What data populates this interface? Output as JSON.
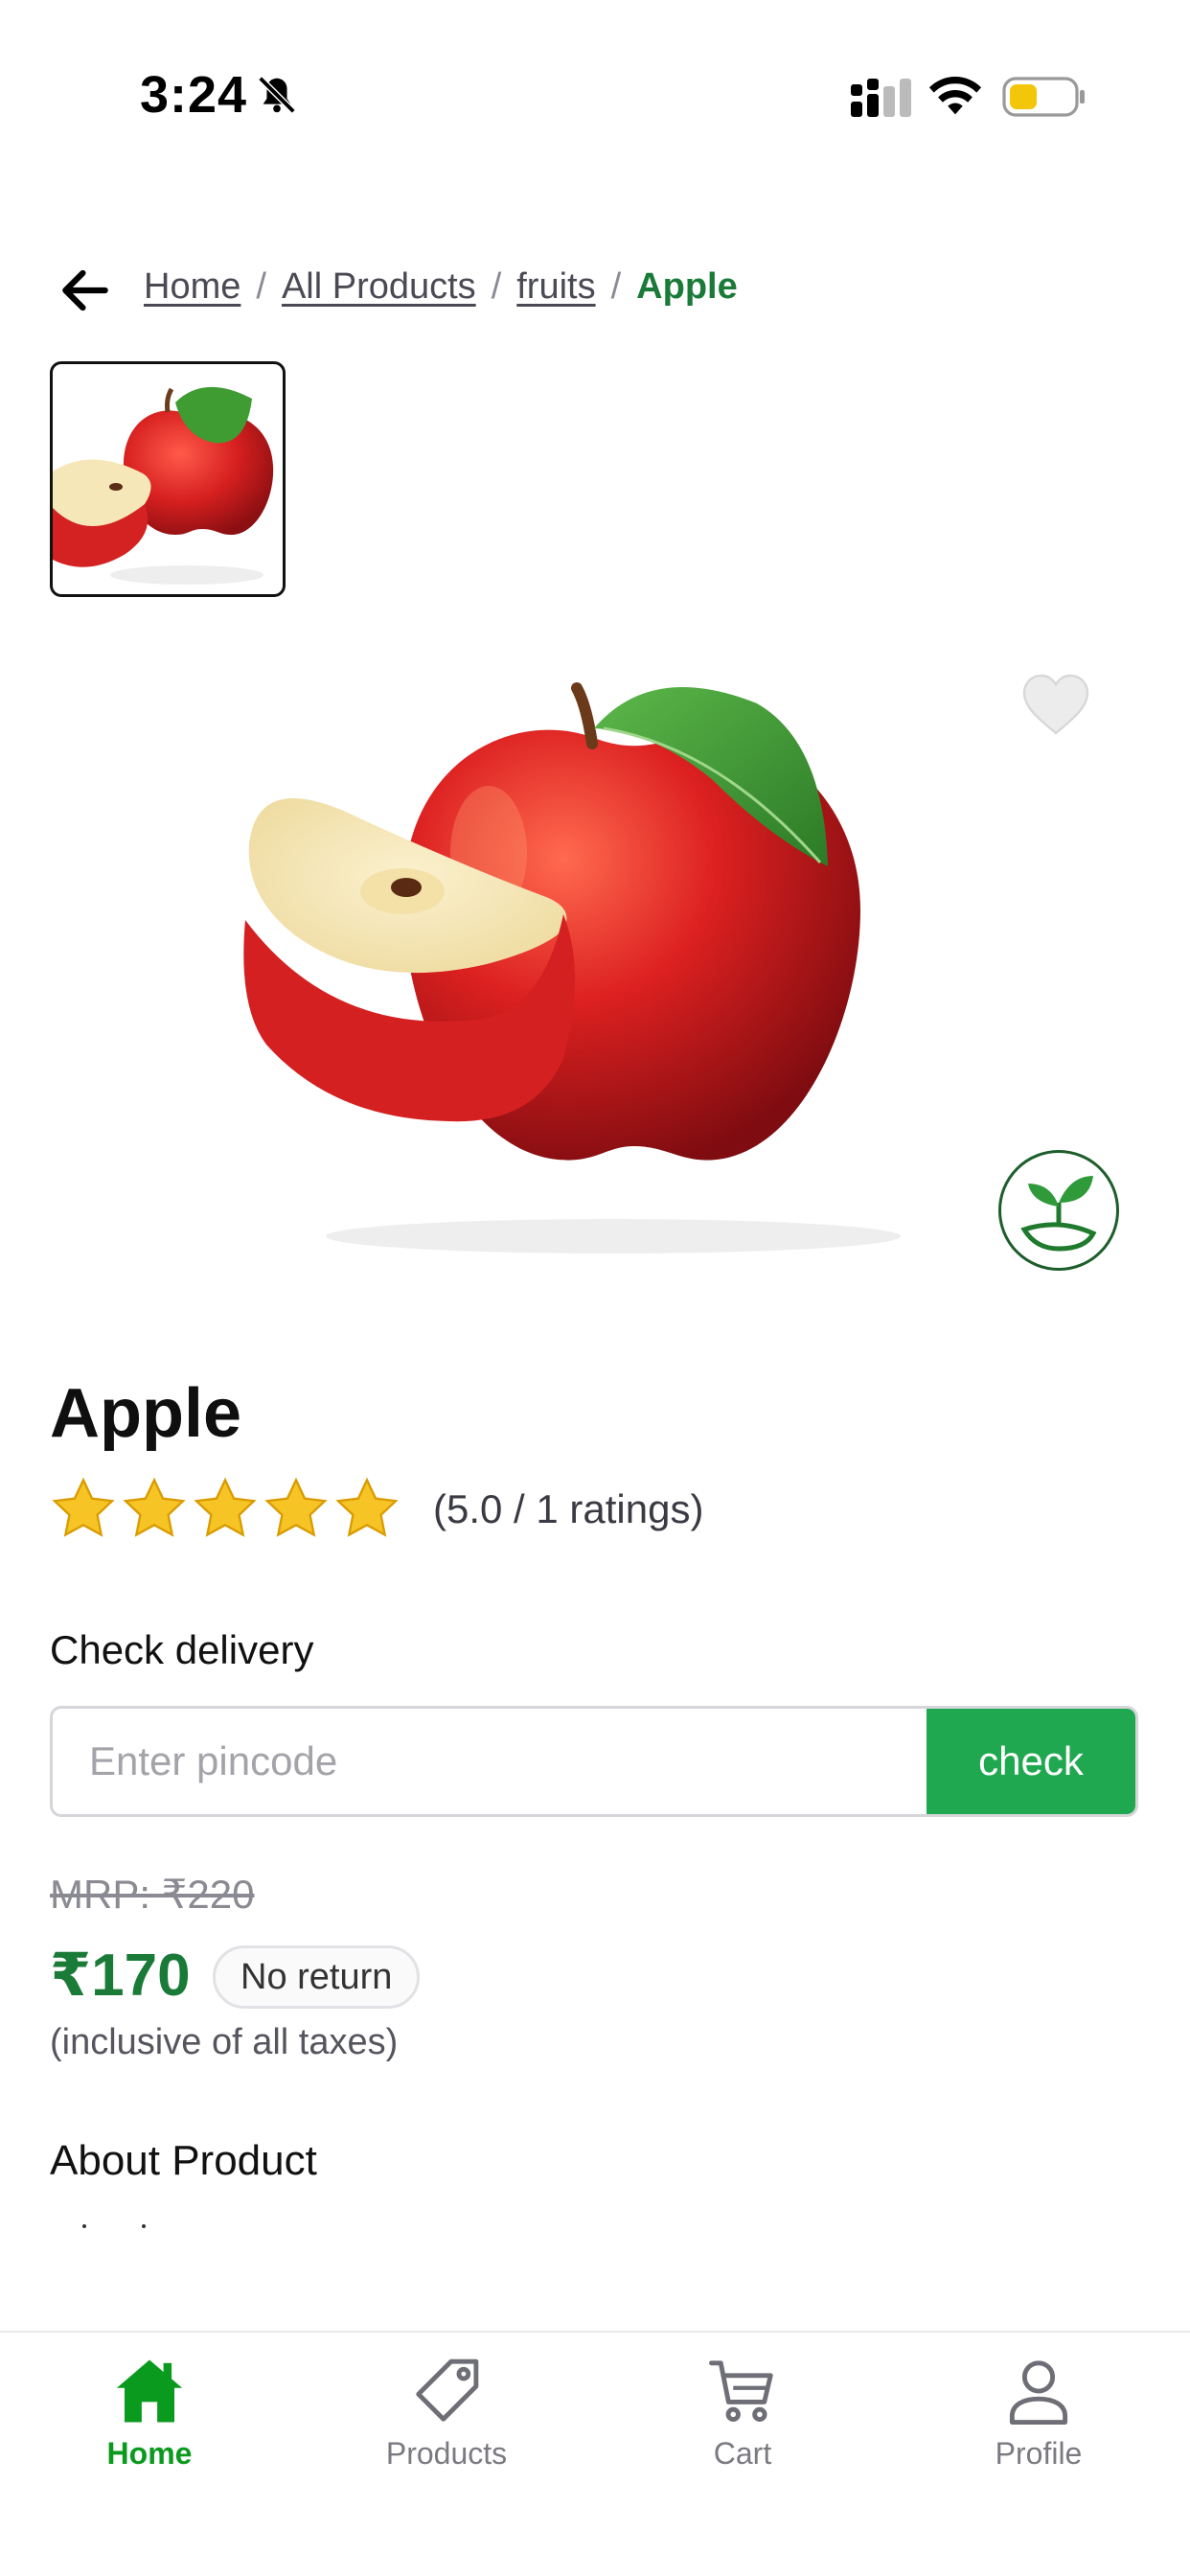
{
  "status_bar": {
    "time": "3:24"
  },
  "breadcrumb": {
    "items": [
      "Home",
      "All Products",
      "fruits"
    ],
    "separator": "/",
    "current": "Apple"
  },
  "product": {
    "title": "Apple",
    "rating_value": 5.0,
    "rating_max": 5,
    "rating_text": "(5.0 / 1 ratings)",
    "wishlisted": false
  },
  "delivery": {
    "label": "Check delivery",
    "pincode_placeholder": "Enter pincode",
    "pincode_value": "",
    "check_label": "check"
  },
  "pricing": {
    "mrp": "MRP: ₹220",
    "price": "₹170",
    "badge": "No return",
    "tax_note": "(inclusive of all taxes)"
  },
  "about": {
    "heading": "About Product"
  },
  "bottom_nav": {
    "items": [
      {
        "label": "Home",
        "icon": "home-icon",
        "active": true
      },
      {
        "label": "Products",
        "icon": "tag-icon",
        "active": false
      },
      {
        "label": "Cart",
        "icon": "cart-icon",
        "active": false
      },
      {
        "label": "Profile",
        "icon": "user-icon",
        "active": false
      }
    ]
  },
  "colors": {
    "brand_green": "#1a7a37",
    "button_green": "#1fa84f",
    "nav_active": "#0a9a1e",
    "star": "#f5b800"
  }
}
